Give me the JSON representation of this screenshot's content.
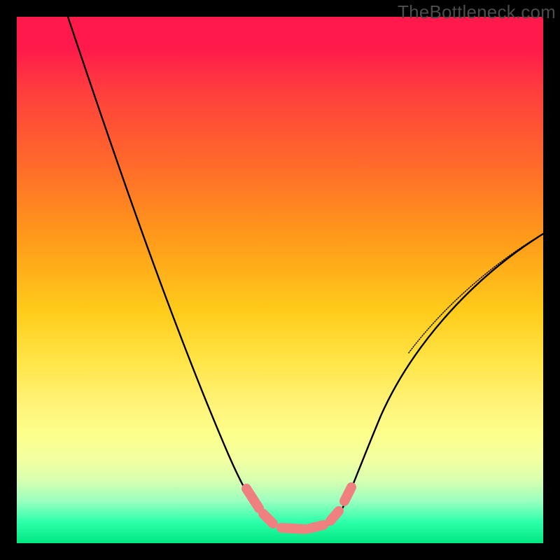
{
  "watermark": "TheBottleneck.com",
  "colors": {
    "curve": "#000000",
    "marker": "#f08080",
    "background_frame": "#000000"
  },
  "chart_data": {
    "type": "line",
    "title": "",
    "xlabel": "",
    "ylabel": "",
    "xlim": [
      0,
      100
    ],
    "ylim": [
      0,
      100
    ],
    "grid": false,
    "legend": false,
    "series": [
      {
        "name": "bottleneck-curve",
        "x": [
          10,
          15,
          20,
          25,
          30,
          35,
          40,
          45,
          48,
          50,
          52,
          55,
          58,
          60,
          62,
          65,
          70,
          75,
          80,
          85,
          90,
          95,
          100
        ],
        "y": [
          100,
          88,
          76,
          64,
          52,
          40,
          28,
          16,
          8,
          4,
          2,
          1,
          1,
          2,
          4,
          8,
          16,
          24,
          32,
          40,
          47,
          53,
          58
        ]
      }
    ],
    "annotations": [
      {
        "name": "optimal-range-markers",
        "shape": "dash-segments",
        "color": "#f08080",
        "x_range": [
          46,
          62
        ],
        "y_approx": 3
      }
    ],
    "gradient_stops": [
      {
        "pos": 0,
        "color": "#ff1a4b"
      },
      {
        "pos": 14,
        "color": "#ff3e3e"
      },
      {
        "pos": 28,
        "color": "#ff6a2a"
      },
      {
        "pos": 42,
        "color": "#ff9a1a"
      },
      {
        "pos": 56,
        "color": "#ffcc1a"
      },
      {
        "pos": 66,
        "color": "#ffe64a"
      },
      {
        "pos": 74,
        "color": "#fff37a"
      },
      {
        "pos": 84,
        "color": "#f3ffa0"
      },
      {
        "pos": 92,
        "color": "#9affc0"
      },
      {
        "pos": 100,
        "color": "#00e882"
      }
    ]
  }
}
